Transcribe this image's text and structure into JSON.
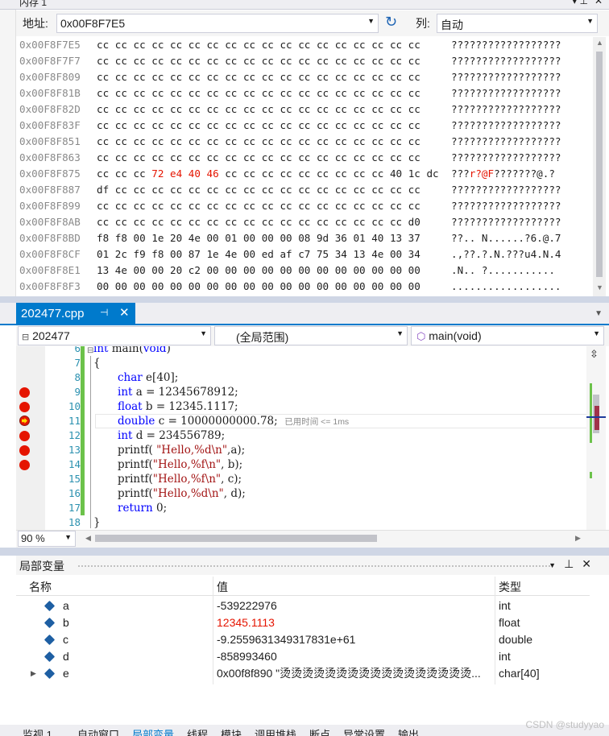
{
  "memory": {
    "title": "内存 1",
    "address_label": "地址:",
    "address_value": "0x00F8F7E5",
    "columns_label": "列:",
    "columns_value": "自动",
    "rows": [
      {
        "addr": "0x00F8F7E5",
        "bytes": [
          "cc",
          "cc",
          "cc",
          "cc",
          "cc",
          "cc",
          "cc",
          "cc",
          "cc",
          "cc",
          "cc",
          "cc",
          "cc",
          "cc",
          "cc",
          "cc",
          "cc",
          "cc"
        ],
        "ascii": "??????????????????"
      },
      {
        "addr": "0x00F8F7F7",
        "bytes": [
          "cc",
          "cc",
          "cc",
          "cc",
          "cc",
          "cc",
          "cc",
          "cc",
          "cc",
          "cc",
          "cc",
          "cc",
          "cc",
          "cc",
          "cc",
          "cc",
          "cc",
          "cc"
        ],
        "ascii": "??????????????????"
      },
      {
        "addr": "0x00F8F809",
        "bytes": [
          "cc",
          "cc",
          "cc",
          "cc",
          "cc",
          "cc",
          "cc",
          "cc",
          "cc",
          "cc",
          "cc",
          "cc",
          "cc",
          "cc",
          "cc",
          "cc",
          "cc",
          "cc"
        ],
        "ascii": "??????????????????"
      },
      {
        "addr": "0x00F8F81B",
        "bytes": [
          "cc",
          "cc",
          "cc",
          "cc",
          "cc",
          "cc",
          "cc",
          "cc",
          "cc",
          "cc",
          "cc",
          "cc",
          "cc",
          "cc",
          "cc",
          "cc",
          "cc",
          "cc"
        ],
        "ascii": "??????????????????"
      },
      {
        "addr": "0x00F8F82D",
        "bytes": [
          "cc",
          "cc",
          "cc",
          "cc",
          "cc",
          "cc",
          "cc",
          "cc",
          "cc",
          "cc",
          "cc",
          "cc",
          "cc",
          "cc",
          "cc",
          "cc",
          "cc",
          "cc"
        ],
        "ascii": "??????????????????"
      },
      {
        "addr": "0x00F8F83F",
        "bytes": [
          "cc",
          "cc",
          "cc",
          "cc",
          "cc",
          "cc",
          "cc",
          "cc",
          "cc",
          "cc",
          "cc",
          "cc",
          "cc",
          "cc",
          "cc",
          "cc",
          "cc",
          "cc"
        ],
        "ascii": "??????????????????"
      },
      {
        "addr": "0x00F8F851",
        "bytes": [
          "cc",
          "cc",
          "cc",
          "cc",
          "cc",
          "cc",
          "cc",
          "cc",
          "cc",
          "cc",
          "cc",
          "cc",
          "cc",
          "cc",
          "cc",
          "cc",
          "cc",
          "cc"
        ],
        "ascii": "??????????????????"
      },
      {
        "addr": "0x00F8F863",
        "bytes": [
          "cc",
          "cc",
          "cc",
          "cc",
          "cc",
          "cc",
          "cc",
          "cc",
          "cc",
          "cc",
          "cc",
          "cc",
          "cc",
          "cc",
          "cc",
          "cc",
          "cc",
          "cc"
        ],
        "ascii": "??????????????????"
      },
      {
        "addr": "0x00F8F875",
        "bytes_pre": "cc cc cc ",
        "bytes_red": "72 e4 40 46",
        "bytes_post": " cc cc cc cc cc cc cc cc cc 40 1c dc",
        "ascii_pre": "???",
        "ascii_red": "r?@F",
        "ascii_post": "???????@.?"
      },
      {
        "addr": "0x00F8F887",
        "bytes": [
          "df",
          "cc",
          "cc",
          "cc",
          "cc",
          "cc",
          "cc",
          "cc",
          "cc",
          "cc",
          "cc",
          "cc",
          "cc",
          "cc",
          "cc",
          "cc",
          "cc",
          "cc"
        ],
        "ascii": "??????????????????"
      },
      {
        "addr": "0x00F8F899",
        "bytes": [
          "cc",
          "cc",
          "cc",
          "cc",
          "cc",
          "cc",
          "cc",
          "cc",
          "cc",
          "cc",
          "cc",
          "cc",
          "cc",
          "cc",
          "cc",
          "cc",
          "cc",
          "cc"
        ],
        "ascii": "??????????????????"
      },
      {
        "addr": "0x00F8F8AB",
        "bytes": [
          "cc",
          "cc",
          "cc",
          "cc",
          "cc",
          "cc",
          "cc",
          "cc",
          "cc",
          "cc",
          "cc",
          "cc",
          "cc",
          "cc",
          "cc",
          "cc",
          "cc",
          "d0"
        ],
        "ascii": "??????????????????"
      },
      {
        "addr": "0x00F8F8BD",
        "bytes": [
          "f8",
          "f8",
          "00",
          "1e",
          "20",
          "4e",
          "00",
          "01",
          "00",
          "00",
          "00",
          "08",
          "9d",
          "36",
          "01",
          "40",
          "13",
          "37"
        ],
        "ascii": "??.. N......?6.@.7"
      },
      {
        "addr": "0x00F8F8CF",
        "bytes": [
          "01",
          "2c",
          "f9",
          "f8",
          "00",
          "87",
          "1e",
          "4e",
          "00",
          "ed",
          "af",
          "c7",
          "75",
          "34",
          "13",
          "4e",
          "00",
          "34"
        ],
        "ascii": ".,??.?.N.???u4.N.4"
      },
      {
        "addr": "0x00F8F8E1",
        "bytes": [
          "13",
          "4e",
          "00",
          "00",
          "20",
          "c2",
          "00",
          "00",
          "00",
          "00",
          "00",
          "00",
          "00",
          "00",
          "00",
          "00",
          "00",
          "00"
        ],
        "ascii": ".N.. ?..........."
      },
      {
        "addr": "0x00F8F8F3",
        "bytes": [
          "00",
          "00",
          "00",
          "00",
          "00",
          "00",
          "00",
          "00",
          "00",
          "00",
          "00",
          "00",
          "00",
          "00",
          "00",
          "00",
          "00",
          "00"
        ],
        "ascii": ".................."
      }
    ]
  },
  "editor": {
    "tab_label": "202477.cpp",
    "project_combo": "202477",
    "scope_combo": "(全局范围)",
    "function_combo": "main(void)",
    "zoom": "90 %",
    "lines": [
      {
        "num": "6",
        "text": "int main(void)"
      },
      {
        "num": "7",
        "text": "{"
      },
      {
        "num": "8",
        "text": "char e[40];"
      },
      {
        "num": "9",
        "text": "int a = 12345678912;"
      },
      {
        "num": "10",
        "text": "float b = 12345.1117;"
      },
      {
        "num": "11",
        "text": "double c = 10000000000.78;"
      },
      {
        "num": "12",
        "text": "int d = 234556789;"
      },
      {
        "num": "13",
        "text": "printf( \"Hello,%d\\n\",a);"
      },
      {
        "num": "14",
        "text": "printf(\"Hello,%f\\n\", b);"
      },
      {
        "num": "15",
        "text": "printf(\"Hello,%f\\n\", c);"
      },
      {
        "num": "16",
        "text": "printf(\"Hello,%d\\n\", d);"
      },
      {
        "num": "17",
        "text": "return 0;"
      },
      {
        "num": "18",
        "text": "}"
      }
    ],
    "elapsed_hint": "已用时间 <= 1ms"
  },
  "locals": {
    "title": "局部变量",
    "headers": {
      "name": "名称",
      "value": "值",
      "type": "类型"
    },
    "rows": [
      {
        "name": "a",
        "value": "-539222976",
        "type": "int",
        "changed": false
      },
      {
        "name": "b",
        "value": "12345.1113",
        "type": "float",
        "changed": true
      },
      {
        "name": "c",
        "value": "-9.2559631349317831e+61",
        "type": "double",
        "changed": false
      },
      {
        "name": "d",
        "value": "-858993460",
        "type": "int",
        "changed": false
      },
      {
        "name": "e",
        "value": "0x00f8f890 \"烫烫烫烫烫烫烫烫烫烫烫烫烫烫烫烫烫...",
        "type": "char[40]",
        "changed": false
      }
    ],
    "bottom_tabs": [
      "监视 1",
      "自动窗口",
      "局部变量",
      "线程",
      "模块",
      "调用堆栈",
      "断点",
      "异常设置",
      "输出"
    ]
  },
  "watermark": "CSDN @studyyao",
  "colors": {
    "accent": "#007acc",
    "breakpoint": "#e51400",
    "keyword": "#0000ff",
    "string": "#a31515",
    "changed": "#e51400"
  }
}
